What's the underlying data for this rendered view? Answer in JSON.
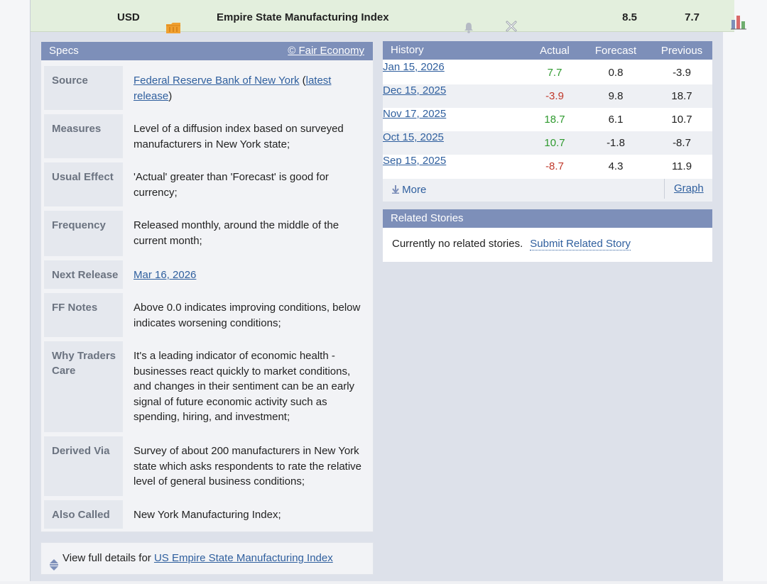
{
  "event": {
    "currency": "USD",
    "name": "Empire State Manufacturing Index",
    "forecast": "8.5",
    "actual": "7.7",
    "impact_color": "#f0a030"
  },
  "specs": {
    "header": "Specs",
    "credit": "© Fair Economy",
    "rows": [
      {
        "label": "Source",
        "link": "Federal Reserve Bank of New York",
        "open": " (",
        "link2": "latest release",
        "close": ")"
      },
      {
        "label": "Measures",
        "value": "Level of a diffusion index based on surveyed manufacturers in New York state;"
      },
      {
        "label": "Usual Effect",
        "value": "'Actual' greater than 'Forecast' is good for currency;"
      },
      {
        "label": "Frequency",
        "value": "Released monthly, around the middle of the current month;"
      },
      {
        "label": "Next Release",
        "link": "Mar 16, 2026"
      },
      {
        "label": "FF Notes",
        "value": "Above 0.0 indicates improving conditions, below indicates worsening conditions;"
      },
      {
        "label": "Why Traders Care",
        "value": "It's a leading indicator of economic health - businesses react quickly to market conditions, and changes in their sentiment can be an early signal of future economic activity such as spending, hiring, and investment;"
      },
      {
        "label": "Derived Via",
        "value": "Survey of about 200 manufacturers in New York state which asks respondents to rate the relative level of general business conditions;"
      },
      {
        "label": "Also Called",
        "value": "New York Manufacturing Index;"
      }
    ]
  },
  "history": {
    "header": "History",
    "columns": [
      "Actual",
      "Forecast",
      "Previous"
    ],
    "rows": [
      {
        "date": "Jan 15, 2026",
        "actual": "7.7",
        "forecast": "0.8",
        "previous": "-3.9"
      },
      {
        "date": "Dec 15, 2025",
        "actual": "-3.9",
        "forecast": "9.8",
        "previous": "18.7"
      },
      {
        "date": "Nov 17, 2025",
        "actual": "18.7",
        "forecast": "6.1",
        "previous": "10.7"
      },
      {
        "date": "Oct 15, 2025",
        "actual": "10.7",
        "forecast": "-1.8",
        "previous": "-8.7"
      },
      {
        "date": "Sep 15, 2025",
        "actual": "-8.7",
        "forecast": "4.3",
        "previous": "11.9"
      }
    ],
    "more_label": "More",
    "graph_label": "Graph"
  },
  "related": {
    "header": "Related Stories",
    "empty_text": "Currently no related stories.",
    "submit_label": "Submit Related Story"
  },
  "full_details": {
    "prefix": "View full details for",
    "link": "US Empire State Manufacturing Index"
  }
}
